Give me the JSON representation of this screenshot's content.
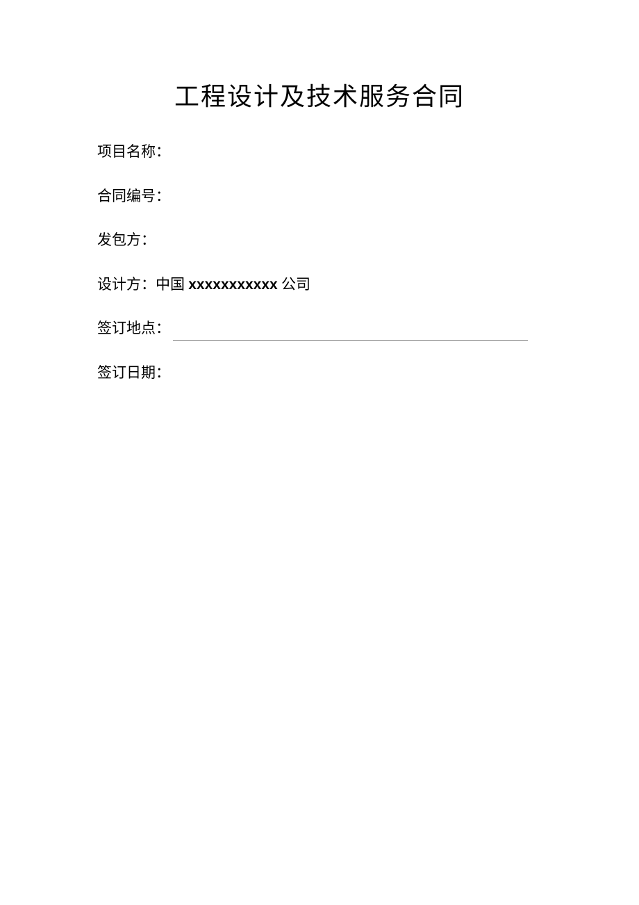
{
  "title": "工程设计及技术服务合同",
  "fields": {
    "project_name": {
      "label": "项目名称：",
      "value": ""
    },
    "contract_number": {
      "label": "合同编号：",
      "value": ""
    },
    "employer": {
      "label": "发包方：",
      "value": ""
    },
    "designer": {
      "label": "设计方：",
      "value_prefix": "中国 ",
      "value_bold": "xxxxxxxxxxx",
      "value_suffix": " 公司"
    },
    "sign_location": {
      "label": "签订地点：",
      "value": ""
    },
    "sign_date": {
      "label": "签订日期：",
      "value": ""
    }
  }
}
